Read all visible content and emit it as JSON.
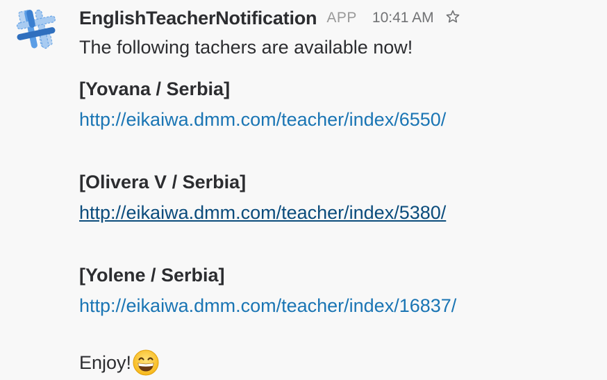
{
  "message": {
    "sender": "EnglishTeacherNotification",
    "badge": "APP",
    "timestamp": "10:41 AM",
    "star_icon": "star-outline-icon",
    "intro": "The following tachers are available now!",
    "teachers": [
      {
        "name": "[Yovana / Serbia]",
        "url": "http://eikaiwa.dmm.com/teacher/index/6550/"
      },
      {
        "name": "[Olivera V / Serbia]",
        "url": "http://eikaiwa.dmm.com/teacher/index/5380/"
      },
      {
        "name": "[Yolene / Serbia]",
        "url": "http://eikaiwa.dmm.com/teacher/index/16837/"
      }
    ],
    "closing": "Enjoy!",
    "closing_emoji": "grinning-face-emoji"
  },
  "colors": {
    "background": "#f8f8f8",
    "text": "#2c2d30",
    "link": "#1a75b4",
    "link_hover": "#0b4c7c",
    "muted": "#717274",
    "avatar_blue": "#4a90d9",
    "avatar_dark": "#2b6cb8"
  }
}
